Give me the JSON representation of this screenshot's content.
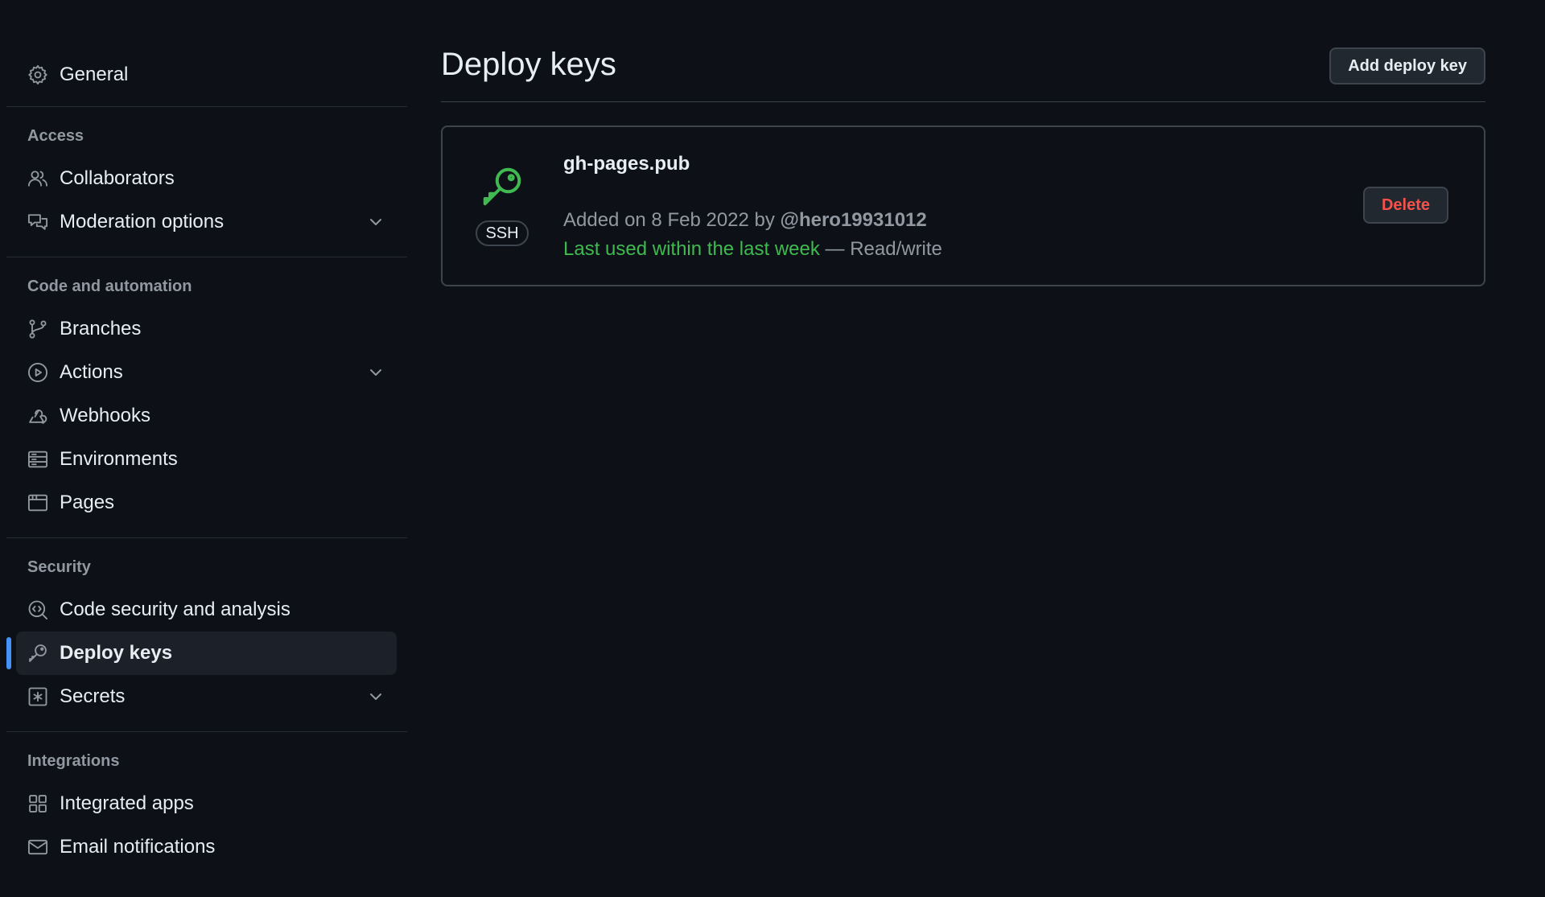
{
  "sidebar": {
    "general": {
      "label": "General",
      "icon": "gear-icon"
    },
    "sections": [
      {
        "heading": "Access",
        "items": [
          {
            "label": "Collaborators",
            "icon": "people-icon"
          },
          {
            "label": "Moderation options",
            "icon": "comment-discussion-icon",
            "expandable": true
          }
        ]
      },
      {
        "heading": "Code and automation",
        "items": [
          {
            "label": "Branches",
            "icon": "git-branch-icon"
          },
          {
            "label": "Actions",
            "icon": "play-icon",
            "expandable": true
          },
          {
            "label": "Webhooks",
            "icon": "webhook-icon"
          },
          {
            "label": "Environments",
            "icon": "server-icon"
          },
          {
            "label": "Pages",
            "icon": "browser-icon"
          }
        ]
      },
      {
        "heading": "Security",
        "items": [
          {
            "label": "Code security and analysis",
            "icon": "codescan-icon"
          },
          {
            "label": "Deploy keys",
            "icon": "key-icon",
            "active": true
          },
          {
            "label": "Secrets",
            "icon": "key-asterisk-icon",
            "expandable": true
          }
        ]
      },
      {
        "heading": "Integrations",
        "items": [
          {
            "label": "Integrated apps",
            "icon": "apps-icon"
          },
          {
            "label": "Email notifications",
            "icon": "mail-icon"
          }
        ]
      }
    ]
  },
  "main": {
    "title": "Deploy keys",
    "add_button": "Add deploy key",
    "key": {
      "name": "gh-pages.pub",
      "type": "SSH",
      "added_prefix": "Added on 8 Feb 2022 by",
      "author": "@hero19931012",
      "last_used": "Last used within the last week",
      "separator": "—",
      "permission": "Read/write",
      "delete_button": "Delete"
    }
  },
  "colors": {
    "background": "#0d1117",
    "active_indicator": "#4493f8",
    "success_green": "#3fb950",
    "danger_red": "#f85149"
  }
}
